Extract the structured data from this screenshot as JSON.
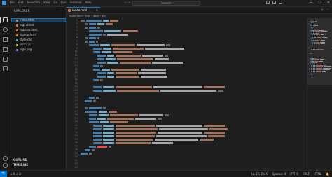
{
  "titlebar": {
    "menu": [
      "File",
      "Edit",
      "Selection",
      "View",
      "Go",
      "Run",
      "Terminal",
      "Help"
    ],
    "nav_arrows": "← →",
    "search_placeholder": "Search",
    "window_controls": [
      "—",
      "☐",
      "✕"
    ]
  },
  "activity_icons": [
    "files-icon",
    "search-icon",
    "source-control-icon",
    "run-debug-icon",
    "extensions-icon",
    "remote-explorer-icon"
  ],
  "activity_bottom_icons": [
    "account-icon",
    "manage-gear-icon"
  ],
  "sidebar": {
    "title": "EXPLORER",
    "more": "···",
    "section": "",
    "items": [
      {
        "label": "index.html",
        "color": "#e37933",
        "selected": true
      },
      {
        "label": "login.html",
        "color": "#e37933",
        "selected": false
      },
      {
        "label": "register.html",
        "color": "#e37933",
        "selected": false
      },
      {
        "label": "signup.html",
        "color": "#e37933",
        "selected": false
      },
      {
        "label": "style.css",
        "color": "#519aba",
        "selected": false
      },
      {
        "label": "script.js",
        "color": "#cbcb41",
        "selected": false
      },
      {
        "label": "logo.png",
        "color": "#a074c4",
        "selected": false
      }
    ],
    "outline_label": "OUTLINE",
    "timeline_label": "TIMELINE"
  },
  "tab": {
    "label": "index.html",
    "close": "×"
  },
  "tab_actions": [
    "▷",
    "⋯"
  ],
  "breadcrumb": "index.html › html › body › div",
  "editor": {
    "first_line": 1,
    "line_count": 43,
    "colors": {
      "tag": "#569cd6",
      "attr": "#9cdcfe",
      "string": "#ce9178",
      "text": "#d4d4d4",
      "punct": "#808080",
      "error": "#f14c4c"
    }
  },
  "statusbar": {
    "left": [
      "⊗ 0 ⚠ 0"
    ],
    "right": [
      "Ln 12, Col 9",
      "Spaces: 4",
      "UTF-8",
      "CRLF",
      "HTML",
      "🔔"
    ]
  }
}
